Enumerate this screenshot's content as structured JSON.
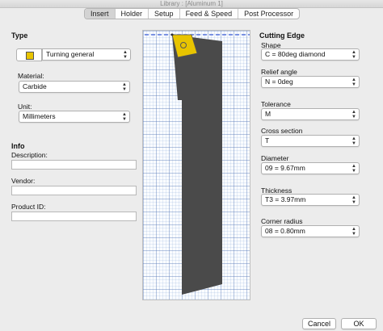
{
  "window": {
    "title": "Library : [Aluminum 1]"
  },
  "tabs": [
    {
      "label": "Insert"
    },
    {
      "label": "Holder"
    },
    {
      "label": "Setup"
    },
    {
      "label": "Feed & Speed"
    },
    {
      "label": "Post Processor"
    }
  ],
  "left": {
    "type_heading": "Type",
    "type_value": "Turning general",
    "material_label": "Material:",
    "material_value": "Carbide",
    "unit_label": "Unit:",
    "unit_value": "Millimeters",
    "info_heading": "Info",
    "description_label": "Description:",
    "vendor_label": "Vendor:",
    "product_id_label": "Product ID:"
  },
  "right": {
    "heading": "Cutting Edge",
    "shape_label": "Shape",
    "shape_value": "C = 80deg diamond",
    "relief_label": "Relief angle",
    "relief_value": "N = 0deg",
    "tolerance_label": "Tolerance",
    "tolerance_value": "M",
    "cross_section_label": "Cross section",
    "cross_section_value": "T",
    "diameter_label": "Diameter",
    "diameter_value": "09 = 9.67mm",
    "thickness_label": "Thickness",
    "thickness_value": "T3 = 3.97mm",
    "corner_radius_label": "Corner radius",
    "corner_radius_value": "08 = 0.80mm"
  },
  "buttons": {
    "cancel": "Cancel",
    "ok": "OK"
  },
  "colors": {
    "insert": "#e8c400",
    "holder": "#4a4a4a",
    "dash_line": "#3b5bd6"
  },
  "icons": {
    "select_arrows": "up-down-chevron",
    "type": "turning-insert-icon"
  }
}
